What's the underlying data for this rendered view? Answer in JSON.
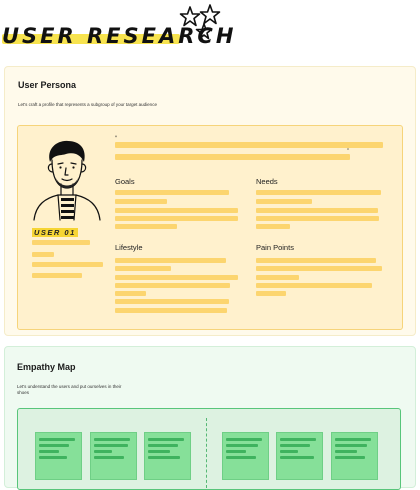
{
  "header": {
    "title": "USER RESEARCH"
  },
  "persona": {
    "title": "User Persona",
    "subtitle": "Let's craft a profile that represents a subgroup of your target audience",
    "user_label": "USER 01",
    "quote_open": "“",
    "quote_close": "”",
    "goals_label": "Goals",
    "needs_label": "Needs",
    "lifestyle_label": "Lifestyle",
    "pain_points_label": "Pain Points"
  },
  "empathy": {
    "title": "Empathy Map",
    "subtitle": "Let's understand the users and put ourselves in their shoes"
  },
  "colors": {
    "persona_bg": "#fffaeb",
    "persona_inner": "#fff1cd",
    "placeholder_yellow": "#fcd56f",
    "empathy_bg": "#effaf1",
    "sticky_green": "#86e099"
  }
}
